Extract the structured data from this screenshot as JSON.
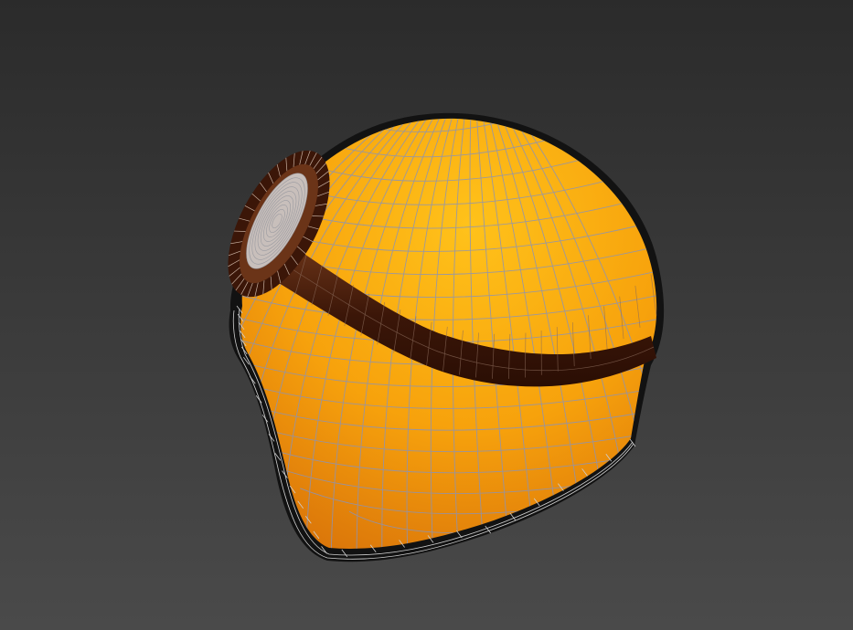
{
  "viewport": {
    "background_top": "#2b2b2b",
    "background_bottom": "#4a4a4a"
  },
  "model": {
    "object": "helmet",
    "shell_color_light": "#ffc21a",
    "shell_color_mid": "#f7a20c",
    "shell_color_dark": "#d9730a",
    "strap_color": "#3b1608",
    "strap_highlight": "#6b3418",
    "rim_color": "#121212",
    "wire_color": "#8a93b8",
    "display_mode": "wireframe-on-shaded"
  }
}
